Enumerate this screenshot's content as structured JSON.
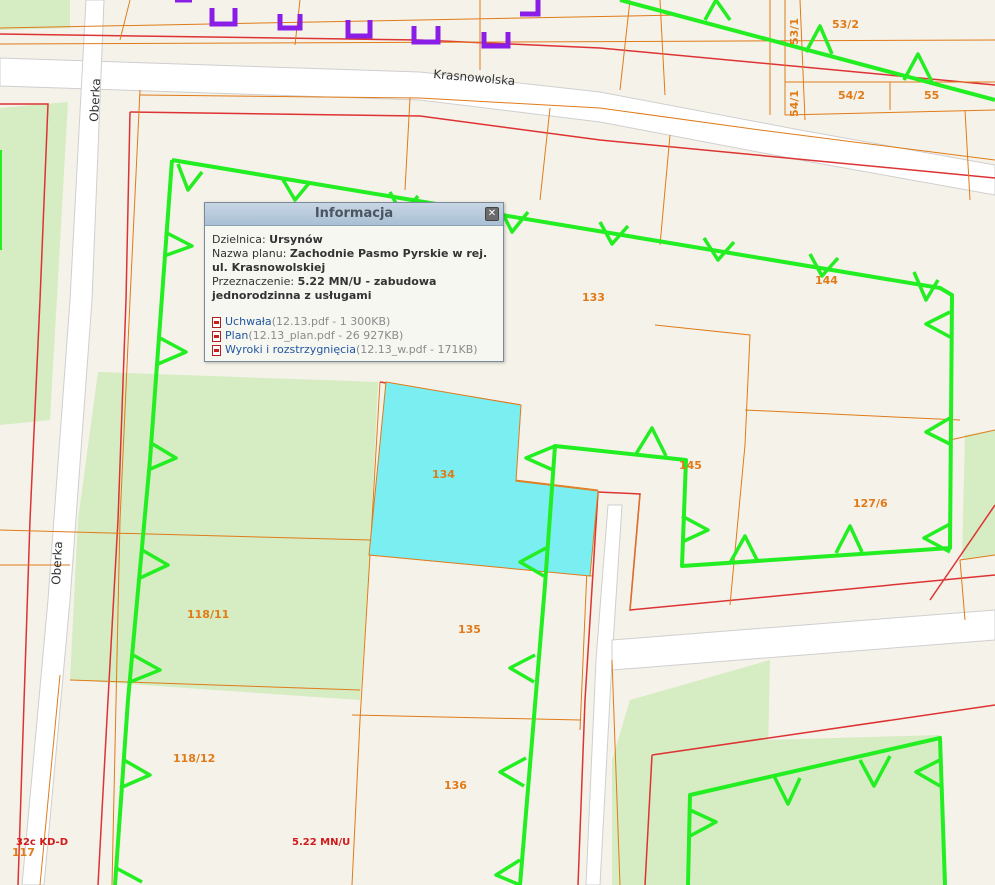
{
  "streets": {
    "krasnowolska": "Krasnowolska",
    "oberka_top": "Oberka",
    "oberka_bottom": "Oberka"
  },
  "parcels": {
    "p53_1": "53/1",
    "p53_2": "53/2",
    "p54_1": "54/1",
    "p54_2": "54/2",
    "p55": "55",
    "p133": "133",
    "p134": "134",
    "p144": "144",
    "p145": "145",
    "p127_6": "127/6",
    "p135": "135",
    "p118_11": "118/11",
    "p118_12": "118/12",
    "p136": "136",
    "p117": "117"
  },
  "plan_labels": {
    "kd": "32c KD-D",
    "mnu": "5.22 MN/U"
  },
  "colors": {
    "plan_boundary": "#22ee22",
    "highlight": "#7aeef0",
    "parcel_line": "#e07b1a",
    "red_line": "#dd3333",
    "green_area": "#d6ecc2",
    "purple": "#8a1ee6"
  },
  "popup": {
    "title": "Informacja",
    "close_icon": "close-icon",
    "district_label": "Dzielnica:",
    "district_value": "Ursynów",
    "plan_name_label": "Nazwa planu:",
    "plan_name_value": "Zachodnie Pasmo Pyrskie w rej. ul. Krasnowolskiej",
    "purpose_label": "Przeznaczenie:",
    "purpose_value": "5.22 MN/U - zabudowa jednorodzinna z usługami",
    "links": [
      {
        "label": "Uchwała",
        "meta": "(12.13.pdf - 1 300KB)"
      },
      {
        "label": "Plan",
        "meta": "(12.13_plan.pdf - 26 927KB)"
      },
      {
        "label": "Wyroki i rozstrzygnięcia",
        "meta": "(12.13_w.pdf - 171KB)"
      }
    ]
  }
}
